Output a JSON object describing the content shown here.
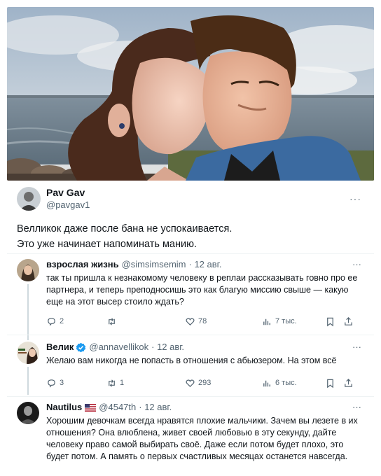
{
  "main_post": {
    "display_name": "Pav Gav",
    "handle": "@pavgav1",
    "text_line1": "Велликок даже после бана не успокаивается.",
    "text_line2": "Это уже начинает напоминать манию.",
    "more": "···"
  },
  "replies": [
    {
      "display_name": "взрослая жизнь",
      "handle": "@simsimsemim",
      "date": "· 12 авг.",
      "text": "так ты пришла к незнакомому человеку в реплаи рассказывать говно про ее партнера, и теперь преподносишь это как благую миссию свыше — какую еще на этот высер стоило ждать?",
      "more": "···",
      "replies_count": "2",
      "reposts_count": "",
      "likes_count": "78",
      "views_count": "7 тыс."
    },
    {
      "display_name": "Велик",
      "handle": "@annavellikok",
      "date": "· 12 авг.",
      "verified": true,
      "text": "Желаю вам никогда не попасть в отношения с абьюзером. На этом всё",
      "more": "···",
      "replies_count": "3",
      "reposts_count": "1",
      "likes_count": "293",
      "views_count": "6 тыс."
    },
    {
      "display_name": "Nautilus",
      "handle": "@4547th",
      "date": "· 12 авг.",
      "flag": "us-flag-icon",
      "text": "Хорошим девочкам всегда нравятся плохие мальчики. Зачем вы лезете в их отношения? Она влюблена, живет своей любовью в эту секунду, дайте человеку право самой выбирать своё. Даже если потом будет плохо, это будет потом. А память о первых счастливых месяцах останется навсегда.",
      "more": "···"
    }
  ],
  "colors": {
    "text": "#0f1419",
    "muted": "#536471",
    "verified": "#1d9bf0",
    "divider": "#eff3f4"
  }
}
